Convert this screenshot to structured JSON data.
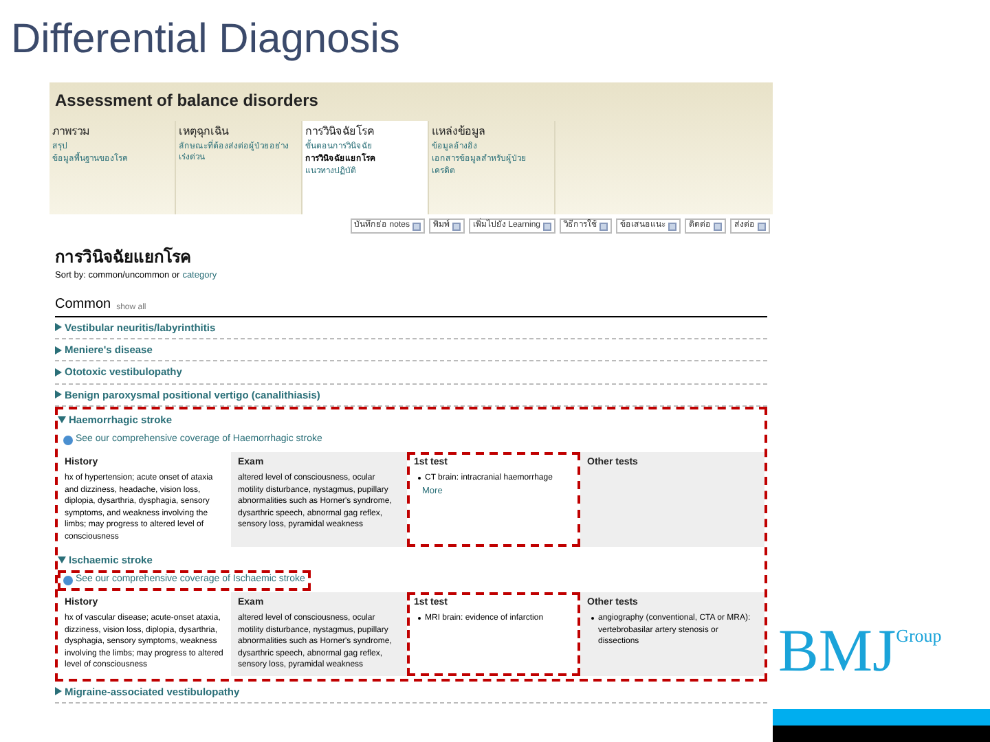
{
  "slide_title": "Differential Diagnosis",
  "logo": {
    "main": "BMJ",
    "sub": "Group"
  },
  "app": {
    "title": "Assessment of balance disorders",
    "nav_columns": [
      {
        "heading": "ภาพรวม",
        "selected": false,
        "links": [
          {
            "label": "สรุป",
            "current": false
          },
          {
            "label": "ข้อมูลพื้นฐานของโรค",
            "current": false
          }
        ]
      },
      {
        "heading": "เหตุฉุกเฉิน",
        "selected": false,
        "links": [
          {
            "label": "ลักษณะที่ต้องส่งต่อผู้ป่วยอย่างเร่งด่วน",
            "current": false
          }
        ]
      },
      {
        "heading": "การวินิจฉัยโรค",
        "selected": true,
        "links": [
          {
            "label": "ขั้นตอนการวินิจฉัย",
            "current": false
          },
          {
            "label": "การวินิจฉัยแยกโรค",
            "current": true
          },
          {
            "label": "แนวทางปฏิบัติ",
            "current": false
          }
        ]
      },
      {
        "heading": "แหล่งข้อมูล",
        "selected": false,
        "links": [
          {
            "label": "ข้อมูลอ้างอิง",
            "current": false
          },
          {
            "label": "เอกสารข้อมูลสำหรับผู้ป่วย",
            "current": false
          },
          {
            "label": "เครดิต",
            "current": false
          }
        ]
      }
    ],
    "toolbar": [
      "บันทึกย่อ notes",
      "พิมพ์",
      "เพิ่มไปยัง Learning",
      "วิธีการใช้",
      "ข้อเสนอแนะ",
      "ติดต่อ",
      "ส่งต่อ"
    ],
    "page_heading": "การวินิจฉัยแยกโรค",
    "sort_prefix": "Sort by: common/uncommon or",
    "sort_link": "category",
    "group_heading": "Common",
    "group_link": "show all",
    "conditions": [
      {
        "name": "Vestibular neuritis/labyrinthitis",
        "expanded": false
      },
      {
        "name": "Meniere's disease",
        "expanded": false
      },
      {
        "name": "Ototoxic vestibulopathy",
        "expanded": false
      },
      {
        "name": "Benign paroxysmal positional vertigo (canalithiasis)",
        "expanded": false
      },
      {
        "name": "Haemorrhagic stroke",
        "expanded": true,
        "highlighted": true,
        "coverage": "See our comprehensive coverage of Haemorrhagic stroke",
        "coverage_highlighted": false,
        "columns": [
          {
            "heading": "History",
            "kind": "text",
            "text": "hx of hypertension; acute onset of ataxia and dizziness, headache, vision loss, diplopia, dysarthria, dysphagia, sensory symptoms, and weakness involving the limbs; may progress to altered level of consciousness",
            "highlighted": false
          },
          {
            "heading": "Exam",
            "kind": "text",
            "text": "altered level of consciousness, ocular motility disturbance, nystagmus, pupillary abnormalities such as Horner's syndrome, dysarthric speech, abnormal gag reflex, sensory loss, pyramidal weakness",
            "highlighted": false
          },
          {
            "heading": "1st test",
            "kind": "bullets",
            "bullets": [
              "CT brain: intracranial haemorrhage"
            ],
            "more": "More",
            "highlighted": true
          },
          {
            "heading": "Other tests",
            "kind": "bullets",
            "highlighted": false
          }
        ]
      },
      {
        "name": "Ischaemic stroke",
        "expanded": true,
        "highlighted": true,
        "coverage": "See our comprehensive coverage of Ischaemic stroke",
        "coverage_highlighted": true,
        "columns": [
          {
            "heading": "History",
            "kind": "text",
            "text": "hx of vascular disease; acute-onset ataxia, dizziness, vision loss, diplopia, dysarthria, dysphagia, sensory symptoms, weakness involving the limbs; may progress to altered level of consciousness",
            "highlighted": false
          },
          {
            "heading": "Exam",
            "kind": "text",
            "text": "altered level of consciousness, ocular motility disturbance, nystagmus, pupillary abnormalities such as Horner's syndrome, dysarthric speech, abnormal gag reflex, sensory loss, pyramidal weakness",
            "highlighted": false
          },
          {
            "heading": "1st test",
            "kind": "bullets",
            "bullets": [
              "MRI brain: evidence of infarction"
            ],
            "highlighted": true
          },
          {
            "heading": "Other tests",
            "kind": "bullets",
            "bullets": [
              "angiography (conventional, CTA or MRA): vertebrobasilar artery stenosis or dissections"
            ],
            "highlighted": false
          }
        ]
      },
      {
        "name": "Migraine-associated vestibulopathy",
        "expanded": false
      }
    ]
  }
}
